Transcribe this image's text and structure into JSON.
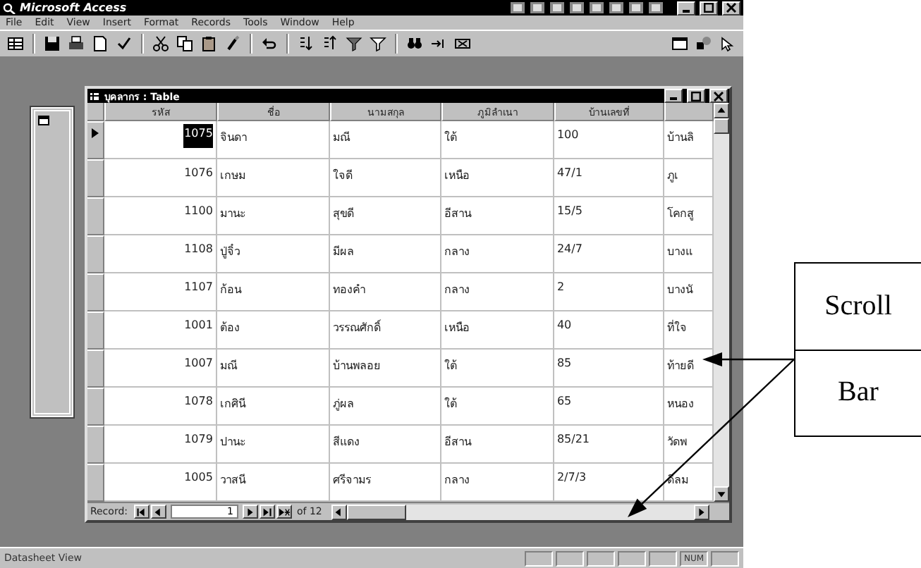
{
  "app": {
    "title": "Microsoft Access",
    "menu": [
      "File",
      "Edit",
      "View",
      "Insert",
      "Format",
      "Records",
      "Tools",
      "Window",
      "Help"
    ],
    "status": "Datasheet View",
    "indicator": "NUM"
  },
  "table_window": {
    "title": "บุคลากร : Table",
    "columns": [
      "รหัส",
      "ชื่อ",
      "นามสกุล",
      "ภูมิลำเนา",
      "บ้านเลขที่"
    ],
    "rows": [
      {
        "selected": true,
        "cells": [
          "1075",
          "จินดา",
          "มณี",
          "ใต้",
          "100",
          "บ้านลิ"
        ]
      },
      {
        "selected": false,
        "cells": [
          "1076",
          "เกษม",
          "ใจดี",
          "เหนือ",
          "47/1",
          "ภูเ"
        ]
      },
      {
        "selected": false,
        "cells": [
          "1100",
          "มานะ",
          "สุขดี",
          "อีสาน",
          "15/5",
          "โคกสู"
        ]
      },
      {
        "selected": false,
        "cells": [
          "1108",
          "ปู่จิ๋ว",
          "มีผล",
          "กลาง",
          "24/7",
          "บางแ"
        ]
      },
      {
        "selected": false,
        "cells": [
          "1107",
          "ก้อน",
          "ทองคำ",
          "กลาง",
          "2",
          "บางนั"
        ]
      },
      {
        "selected": false,
        "cells": [
          "1001",
          "ต้อง",
          "วรรณศักดิ์",
          "เหนือ",
          "40",
          "ที่ใจ"
        ]
      },
      {
        "selected": false,
        "cells": [
          "1007",
          "มณี",
          "บ้านพลอย",
          "ใต้",
          "85",
          "ท้ายดี"
        ]
      },
      {
        "selected": false,
        "cells": [
          "1078",
          "เกศินี",
          "ภู่ผล",
          "ใต้",
          "65",
          "หนอง"
        ]
      },
      {
        "selected": false,
        "cells": [
          "1079",
          "ปานะ",
          "สีแดง",
          "อีสาน",
          "85/21",
          "วัดพ"
        ]
      },
      {
        "selected": false,
        "cells": [
          "1005",
          "วาสนี",
          "ศรีจามร",
          "กลาง",
          "2/7/3",
          "ดีลม"
        ]
      }
    ],
    "navigator": {
      "label": "Record:",
      "current": "1",
      "total": "of 12"
    }
  },
  "callout": {
    "lines": [
      "Scroll",
      "Bar"
    ]
  }
}
